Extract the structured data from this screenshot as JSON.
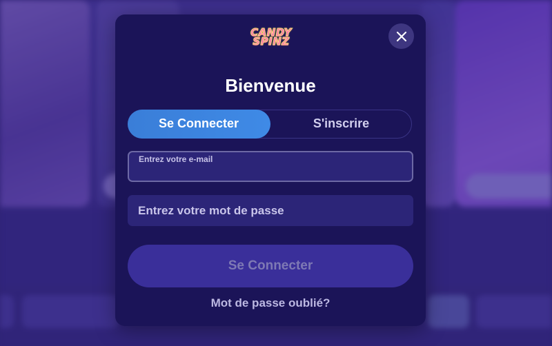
{
  "brand": {
    "logo_line1": "CANDY",
    "logo_line2": "SPINZ"
  },
  "modal": {
    "title": "Bienvenue",
    "tabs": [
      {
        "label": "Se Connecter",
        "active": true
      },
      {
        "label": "S'inscrire",
        "active": false
      }
    ],
    "email_field": {
      "label": "Entrez votre e-mail",
      "value": ""
    },
    "password_field": {
      "placeholder": "Entrez votre mot de passe",
      "value": ""
    },
    "submit_label": "Se Connecter",
    "forgot_label": "Mot de passe oublié?",
    "close_icon": "close-icon"
  },
  "colors": {
    "modal_bg": "#1b1458",
    "tab_active": "#3a7ed8",
    "input_bg": "#2c2578",
    "submit_bg": "#3a2f9a"
  }
}
